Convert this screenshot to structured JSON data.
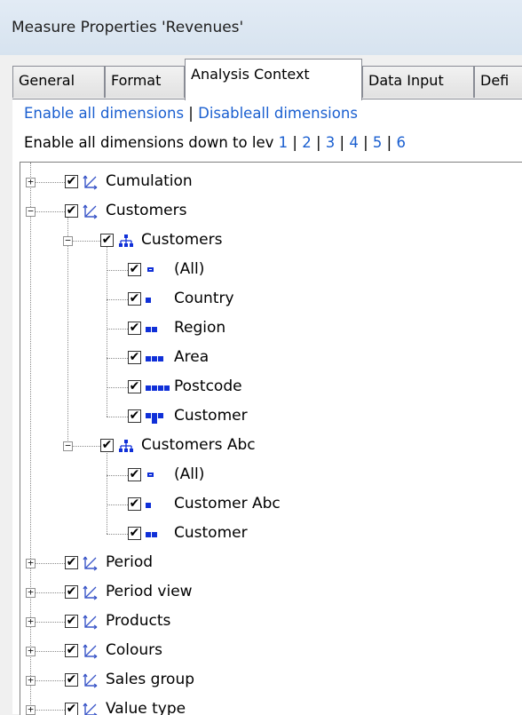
{
  "window": {
    "title": "Measure Properties 'Revenues'"
  },
  "tabs": [
    "General",
    "Format",
    "Analysis Context",
    "Data Input",
    "Defi"
  ],
  "links": {
    "enable_all": "Enable all dimensions",
    "sep": "|",
    "disable_all": "Disableall dimensions",
    "down_to_level_prefix": "Enable all dimensions down to lev",
    "levels": [
      "1",
      "2",
      "3",
      "4",
      "5",
      "6"
    ]
  },
  "tree": {
    "items": [
      {
        "label": "Cumulation",
        "checked": true,
        "icon": "dimension-icon"
      },
      {
        "label": "Customers",
        "checked": true,
        "icon": "dimension-icon",
        "expanded": true
      },
      {
        "label": "Customers",
        "checked": true,
        "icon": "hierarchy-icon",
        "expanded": true
      },
      {
        "label": "(All)",
        "checked": true,
        "icon": "level-all-icon"
      },
      {
        "label": "Country",
        "checked": true,
        "icon": "level-1-icon"
      },
      {
        "label": "Region",
        "checked": true,
        "icon": "level-2-icon"
      },
      {
        "label": "Area",
        "checked": true,
        "icon": "level-3-icon"
      },
      {
        "label": "Postcode",
        "checked": true,
        "icon": "level-4-icon"
      },
      {
        "label": "Customer",
        "checked": true,
        "icon": "level-5-icon"
      },
      {
        "label": "Customers Abc",
        "checked": true,
        "icon": "hierarchy-icon",
        "expanded": true
      },
      {
        "label": "(All)",
        "checked": true,
        "icon": "level-all-icon"
      },
      {
        "label": "Customer Abc",
        "checked": true,
        "icon": "level-1-icon"
      },
      {
        "label": "Customer",
        "checked": true,
        "icon": "level-2-icon"
      },
      {
        "label": "Period",
        "checked": true,
        "icon": "dimension-icon"
      },
      {
        "label": "Period view",
        "checked": true,
        "icon": "dimension-icon"
      },
      {
        "label": "Products",
        "checked": true,
        "icon": "dimension-icon"
      },
      {
        "label": "Colours",
        "checked": true,
        "icon": "dimension-icon"
      },
      {
        "label": "Sales group",
        "checked": true,
        "icon": "dimension-icon"
      },
      {
        "label": "Value type",
        "checked": true,
        "icon": "dimension-icon"
      }
    ],
    "check_glyph": "✔",
    "expand_glyph": "+",
    "collapse_glyph": "−"
  },
  "colors": {
    "link": "#1a5fd0",
    "level_icon": "#1030d8",
    "dimension_icon": "#3a56c8"
  }
}
